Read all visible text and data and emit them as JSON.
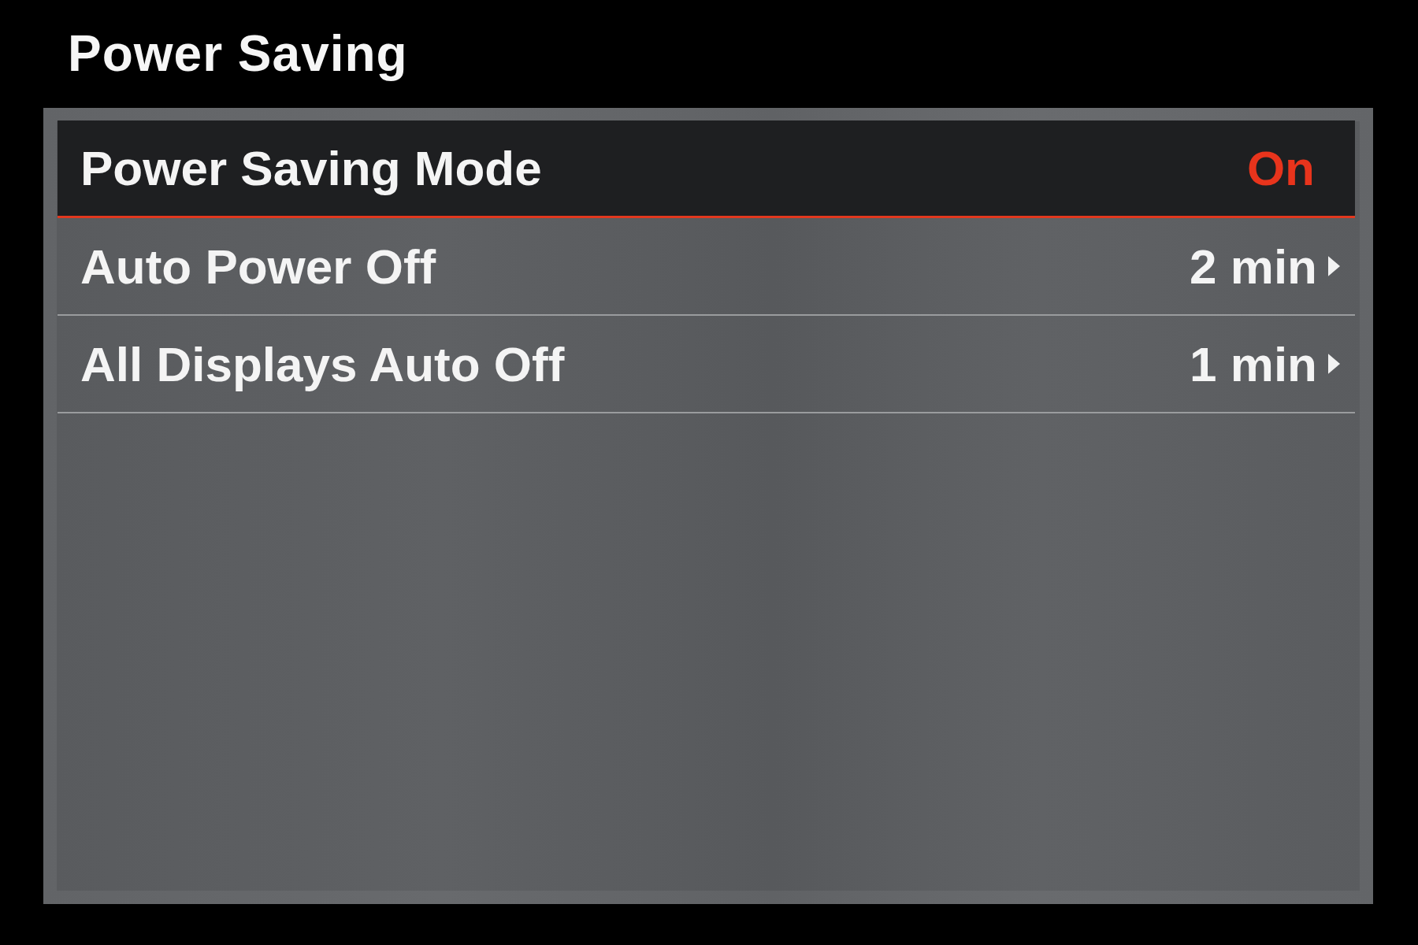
{
  "title": "Power Saving",
  "items": [
    {
      "kind": "toggle",
      "label": "Power Saving Mode",
      "value": "On",
      "selected": true
    },
    {
      "kind": "submenu",
      "label": "Auto Power Off",
      "value": "2 min",
      "selected": false
    },
    {
      "kind": "submenu",
      "label": "All Displays Auto Off",
      "value": "1 min",
      "selected": false
    }
  ]
}
